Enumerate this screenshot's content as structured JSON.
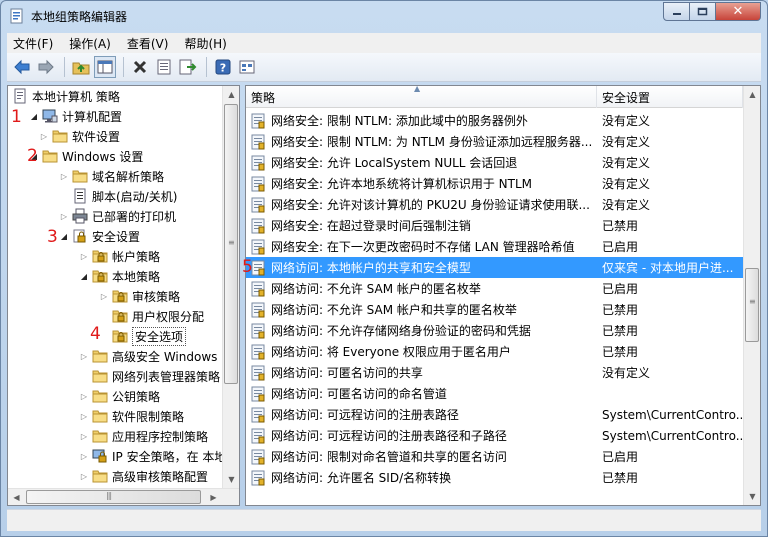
{
  "window": {
    "title": "本地组策略编辑器",
    "controls": {
      "close": "✕"
    }
  },
  "menu": [
    "文件(F)",
    "操作(A)",
    "查看(V)",
    "帮助(H)"
  ],
  "toolbar_icons": [
    "back-icon",
    "forward-icon",
    "up-folder-icon",
    "show-hide-tree-icon",
    "delete-icon",
    "properties-icon",
    "export-icon",
    "help-icon",
    "view-icon"
  ],
  "tree": [
    {
      "label": "本地计算机 策略",
      "icon": "computer-policy-icon",
      "expander": ""
    },
    {
      "label": "计算机配置",
      "icon": "computer-icon",
      "expander": "open"
    },
    {
      "label": "软件设置",
      "icon": "folder-icon",
      "expander": "closed"
    },
    {
      "label": "Windows 设置",
      "icon": "folder-icon",
      "expander": "open"
    },
    {
      "label": "域名解析策略",
      "icon": "folder-icon",
      "expander": "closed"
    },
    {
      "label": "脚本(启动/关机)",
      "icon": "script-icon",
      "expander": ""
    },
    {
      "label": "已部署的打印机",
      "icon": "printer-icon",
      "expander": "closed"
    },
    {
      "label": "安全设置",
      "icon": "security-icon",
      "expander": "open"
    },
    {
      "label": "帐户策略",
      "icon": "security-folder-icon",
      "expander": "closed"
    },
    {
      "label": "本地策略",
      "icon": "security-folder-icon",
      "expander": "open"
    },
    {
      "label": "审核策略",
      "icon": "security-folder-icon",
      "expander": "closed"
    },
    {
      "label": "用户权限分配",
      "icon": "security-folder-icon",
      "expander": ""
    },
    {
      "label": "安全选项",
      "icon": "security-folder-icon",
      "expander": "",
      "selected": true
    },
    {
      "label": "高级安全 Windows l",
      "icon": "folder-icon",
      "expander": "closed"
    },
    {
      "label": "网络列表管理器策略",
      "icon": "folder-icon",
      "expander": ""
    },
    {
      "label": "公钥策略",
      "icon": "folder-icon",
      "expander": "closed"
    },
    {
      "label": "软件限制策略",
      "icon": "folder-icon",
      "expander": "closed"
    },
    {
      "label": "应用程序控制策略",
      "icon": "folder-icon",
      "expander": "closed"
    },
    {
      "label": "IP 安全策略，在 本地",
      "icon": "ip-security-icon",
      "expander": "closed"
    },
    {
      "label": "高级审核策略配置",
      "icon": "folder-icon",
      "expander": "closed"
    }
  ],
  "list": {
    "headers": {
      "policy": "策略",
      "setting": "安全设置"
    },
    "rows": [
      {
        "policy": "网络安全: 限制 NTLM: 添加此域中的服务器例外",
        "setting": "没有定义"
      },
      {
        "policy": "网络安全: 限制 NTLM: 为 NTLM 身份验证添加远程服务器...",
        "setting": "没有定义"
      },
      {
        "policy": "网络安全: 允许 LocalSystem NULL 会话回退",
        "setting": "没有定义"
      },
      {
        "policy": "网络安全: 允许本地系统将计算机标识用于 NTLM",
        "setting": "没有定义"
      },
      {
        "policy": "网络安全: 允许对该计算机的 PKU2U 身份验证请求使用联...",
        "setting": "没有定义"
      },
      {
        "policy": "网络安全: 在超过登录时间后强制注销",
        "setting": "已禁用"
      },
      {
        "policy": "网络安全: 在下一次更改密码时不存储 LAN 管理器哈希值",
        "setting": "已启用"
      },
      {
        "policy": "网络访问: 本地帐户的共享和安全模型",
        "setting": "仅来宾 - 对本地用户进...",
        "selected": true
      },
      {
        "policy": "网络访问: 不允许 SAM 帐户的匿名枚举",
        "setting": "已启用"
      },
      {
        "policy": "网络访问: 不允许 SAM 帐户和共享的匿名枚举",
        "setting": "已禁用"
      },
      {
        "policy": "网络访问: 不允许存储网络身份验证的密码和凭据",
        "setting": "已禁用"
      },
      {
        "policy": "网络访问: 将 Everyone 权限应用于匿名用户",
        "setting": "已禁用"
      },
      {
        "policy": "网络访问: 可匿名访问的共享",
        "setting": "没有定义"
      },
      {
        "policy": "网络访问: 可匿名访问的命名管道",
        "setting": ""
      },
      {
        "policy": "网络访问: 可远程访问的注册表路径",
        "setting": "System\\CurrentContro..."
      },
      {
        "policy": "网络访问: 可远程访问的注册表路径和子路径",
        "setting": "System\\CurrentContro..."
      },
      {
        "policy": "网络访问: 限制对命名管道和共享的匿名访问",
        "setting": "已启用"
      },
      {
        "policy": "网络访问: 允许匿名 SID/名称转换",
        "setting": "已禁用"
      }
    ]
  },
  "annotations": [
    "1",
    "2",
    "3",
    "4",
    "5"
  ],
  "colors": {
    "selection": "#3399ff",
    "annotation": "#e01a1a"
  }
}
